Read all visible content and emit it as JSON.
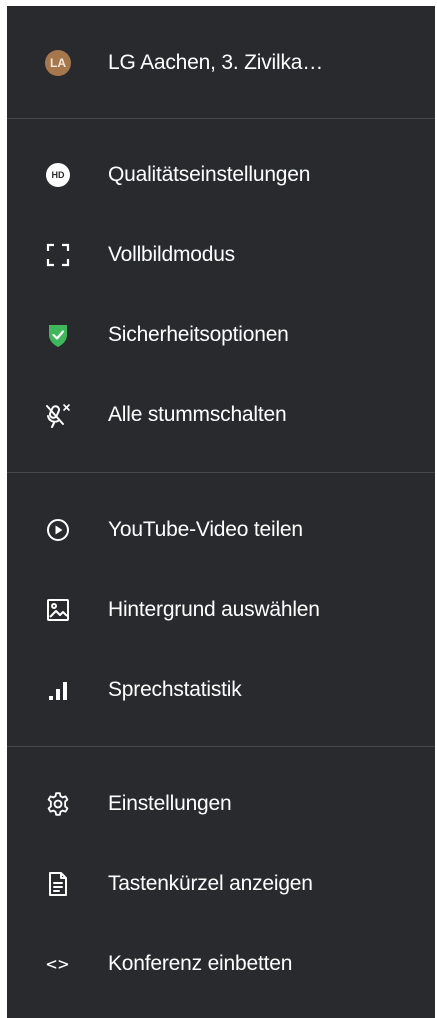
{
  "conference": {
    "avatar_initials": "LA",
    "avatar_color": "#a6774c",
    "name": "LG Aachen, 3. Zivilka…"
  },
  "menu": {
    "background": "#292a2d",
    "section_1": [
      {
        "icon": "hd-icon",
        "icon_text": "HD",
        "label": "Qualitätseinstellungen"
      },
      {
        "icon": "fullscreen-icon",
        "label": "Vollbildmodus"
      },
      {
        "icon": "shield-check-icon",
        "label": "Sicherheitsoptionen"
      },
      {
        "icon": "mic-off-icon",
        "label": "Alle stummschalten"
      }
    ],
    "section_2": [
      {
        "icon": "play-circle-icon",
        "label": "YouTube-Video teilen"
      },
      {
        "icon": "image-icon",
        "label": "Hintergrund auswählen"
      },
      {
        "icon": "bar-chart-icon",
        "label": "Sprechstatistik"
      }
    ],
    "section_3": [
      {
        "icon": "gear-icon",
        "label": "Einstellungen"
      },
      {
        "icon": "document-icon",
        "label": "Tastenkürzel anzeigen"
      },
      {
        "icon": "code-icon",
        "icon_text": "<>",
        "label": "Konferenz einbetten"
      }
    ],
    "shield_color": "#3fb75b"
  }
}
